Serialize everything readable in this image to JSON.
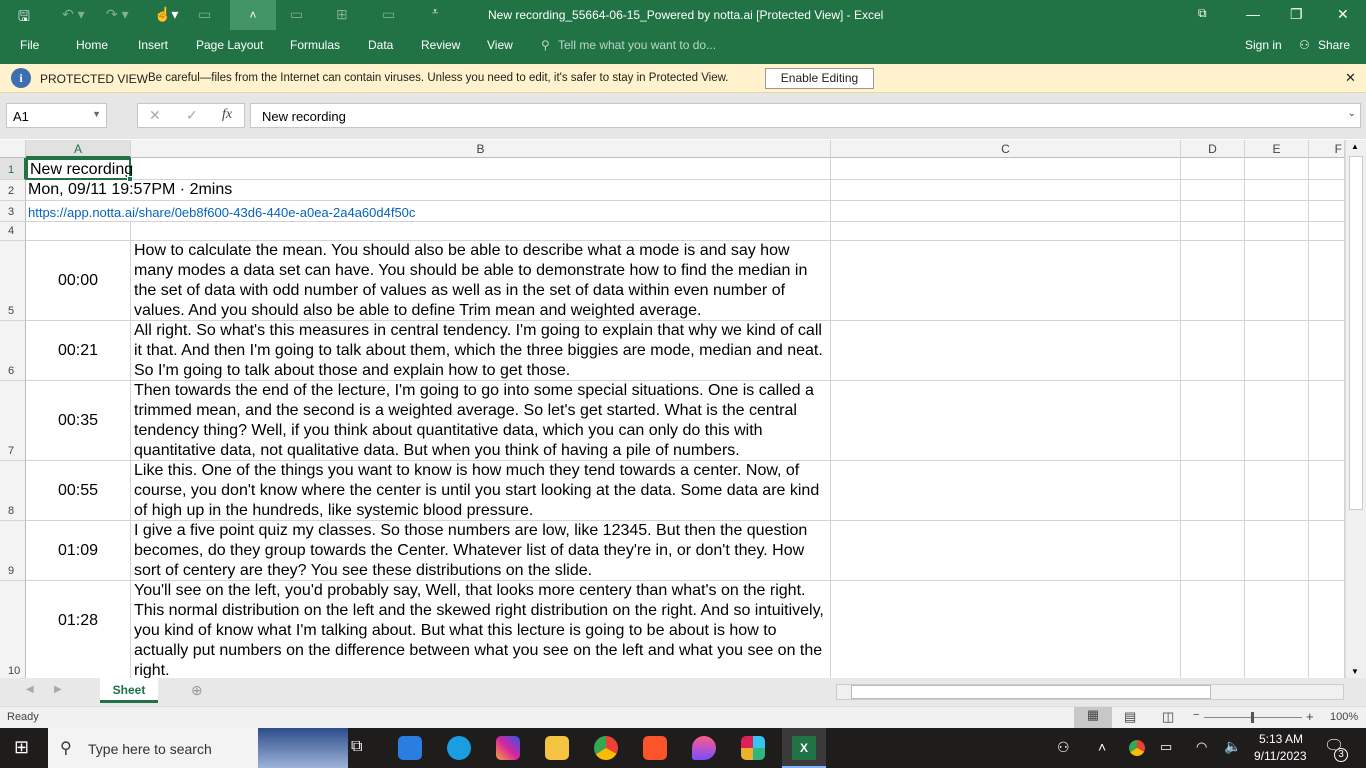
{
  "window": {
    "title": "New recording_55664-06-15_Powered by notta.ai  [Protected View] - Excel"
  },
  "ribbon": {
    "tabs": [
      "File",
      "Home",
      "Insert",
      "Page Layout",
      "Formulas",
      "Data",
      "Review",
      "View"
    ],
    "tell_me": "Tell me what you want to do...",
    "sign_in": "Sign in",
    "share": "Share"
  },
  "protected": {
    "label": "PROTECTED VIEW",
    "message": "Be careful—files from the Internet can contain viruses. Unless you need to edit, it's safer to stay in Protected View.",
    "button": "Enable Editing"
  },
  "formula": {
    "name_box": "A1",
    "fx": "fx",
    "value": "New recording"
  },
  "columns": [
    "A",
    "B",
    "C",
    "D",
    "E",
    "F"
  ],
  "rows": {
    "r1": "New recording",
    "r2": "Mon, 09/11 19:57PM · 2mins",
    "r3": "https://app.notta.ai/share/0eb8f600-43d6-440e-a0ea-2a4a60d4f50c",
    "transcript": [
      {
        "row": "5",
        "time": "00:00",
        "text": "How to calculate the mean. You should also be able to describe what a mode is and say how many modes a data set can have. You should be able to demonstrate how to find the median in the set of data with odd number of values as well as in the set of data within even number of values. And you should also be able to define Trim mean and weighted average."
      },
      {
        "row": "6",
        "time": "00:21",
        "text": "All right. So what's this measures in central tendency. I'm going to explain that why we kind of call it that. And then I'm going to talk about them, which the three biggies are mode, median and neat. So I'm going to talk about those and explain how to get those."
      },
      {
        "row": "7",
        "time": "00:35",
        "text": "Then towards the end of the lecture, I'm going to go into some special situations. One is called a trimmed mean, and the second is a weighted average. So let's get started. What is the central tendency thing? Well, if you think about quantitative data, which you can only do this with quantitative data, not qualitative data. But when you think of having a pile of numbers."
      },
      {
        "row": "8",
        "time": "00:55",
        "text": "Like this. One of the things you want to know is how much they tend towards a center. Now, of course, you don't know where the center is until you start looking at the data. Some data are kind of high up in the hundreds, like systemic blood pressure."
      },
      {
        "row": "9",
        "time": "01:09",
        "text": "I give a five point quiz my classes. So those numbers are low, like 12345. But then the question becomes, do they group towards the Center. Whatever list of data they're in, or don't they. How sort of centery are they? You see these distributions on the slide."
      },
      {
        "row": "10",
        "time": "01:28",
        "text": "You'll see on the left, you'd probably say, Well, that looks more centery than what's on the right. This normal distribution on the left and the skewed right distribution on the right. And so intuitively, you kind of know what I'm talking about. But what this lecture is going to be about is how to actually put numbers on the difference between what you see on the left and what you see on the right."
      }
    ]
  },
  "sheet_tab": "Sheet",
  "status": {
    "ready": "Ready",
    "zoom": "100%",
    "zoom_level": 100
  },
  "taskbar": {
    "search": "Type here to search",
    "time": "5:13 AM",
    "date": "9/11/2023",
    "notifications": "3"
  },
  "colors": {
    "excel_green": "#217346",
    "protected_bar": "#fff2cc",
    "link": "#0563c1"
  }
}
